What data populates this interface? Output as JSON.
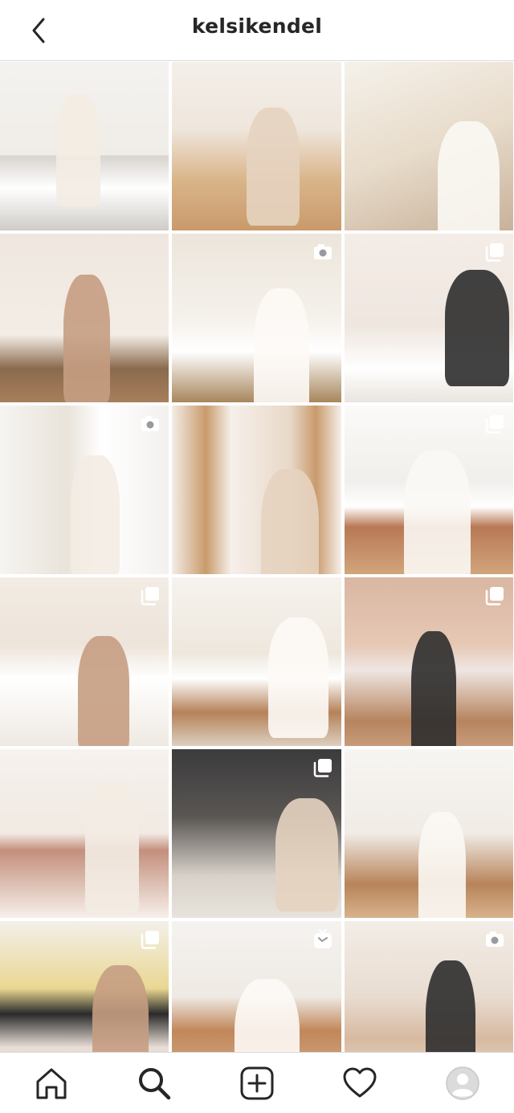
{
  "header": {
    "username": "kelsikendel"
  },
  "tiles": [
    {
      "scene": "kitchen",
      "badge": "none"
    },
    {
      "scene": "s-sit",
      "badge": "none"
    },
    {
      "scene": "s-boots",
      "badge": "none"
    },
    {
      "scene": "s-living",
      "badge": "none"
    },
    {
      "scene": "s-bed",
      "badge": "camera-icon"
    },
    {
      "scene": "s-kids",
      "badge": "multiple-icon"
    },
    {
      "scene": "s-pantry",
      "badge": "camera-icon"
    },
    {
      "scene": "s-mirror",
      "badge": "none"
    },
    {
      "scene": "s-island",
      "badge": "multiple-icon"
    },
    {
      "scene": "s-sofa",
      "badge": "multiple-icon"
    },
    {
      "scene": "s-counter",
      "badge": "none"
    },
    {
      "scene": "s-sweater",
      "badge": "multiple-icon"
    },
    {
      "scene": "s-pink",
      "badge": "none"
    },
    {
      "scene": "s-outdoor",
      "badge": "multiple-icon"
    },
    {
      "scene": "s-white",
      "badge": "none"
    },
    {
      "scene": "s-jackets",
      "badge": "multiple-icon"
    },
    {
      "scene": "s-room",
      "badge": "igtv-icon"
    },
    {
      "scene": "s-mom",
      "badge": "camera-icon"
    },
    {
      "scene": "s-p1",
      "badge": "none"
    },
    {
      "scene": "s-p2",
      "badge": "none"
    },
    {
      "scene": "s-p3",
      "badge": "none"
    }
  ],
  "nav": {
    "items": [
      "home-icon",
      "search-icon",
      "new-post-icon",
      "activity-heart-icon",
      "profile-avatar"
    ]
  }
}
